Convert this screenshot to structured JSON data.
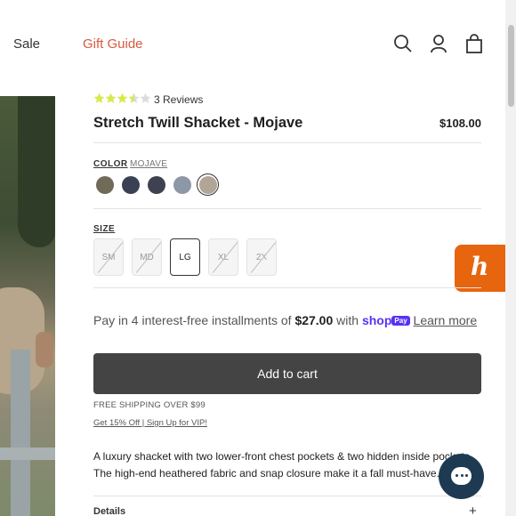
{
  "nav": {
    "sale": "Sale",
    "gift_guide": "Gift Guide",
    "icons": [
      "search-icon",
      "account-icon",
      "cart-bag-icon"
    ]
  },
  "product": {
    "rating": 3.5,
    "rating_max": 5,
    "reviews": "3 Reviews",
    "title": "Stretch Twill Shacket - Mojave",
    "price": "$108.00"
  },
  "color": {
    "label": "COLOR",
    "selected": "MOJAVE",
    "swatches": [
      "#6f6b58",
      "#3b4154",
      "#3e4250",
      "#8e97a6",
      "#b3a595"
    ]
  },
  "size": {
    "label": "SIZE",
    "options": [
      {
        "label": "SM",
        "available": false
      },
      {
        "label": "MD",
        "available": false
      },
      {
        "label": "LG",
        "available": true,
        "selected": true
      },
      {
        "label": "XL",
        "available": false
      },
      {
        "label": "2X",
        "available": false
      }
    ]
  },
  "payment": {
    "prefix": "Pay in 4 interest-free installments of ",
    "amount": "$27.00",
    "middle": " with ",
    "shop": "shop",
    "pay": "Pay",
    "learn_more": "Learn more"
  },
  "cart": {
    "button": "Add to cart",
    "shipping": "FREE SHIPPING OVER $99",
    "vip": "Get 15% Off | Sign Up for VIP!"
  },
  "description": "A luxury shacket with two lower-front chest pockets & two hidden inside pockets. The high-end heathered fabric and snap closure make it a fall must-have.",
  "details": {
    "label": "Details",
    "toggle": "+"
  },
  "colors": {
    "accent": "#d65a3f",
    "button": "#444444",
    "shop_pay": "#5a31f4",
    "honey": "#e8650f",
    "chat": "#1d3a52",
    "star": "#d8e84a"
  }
}
